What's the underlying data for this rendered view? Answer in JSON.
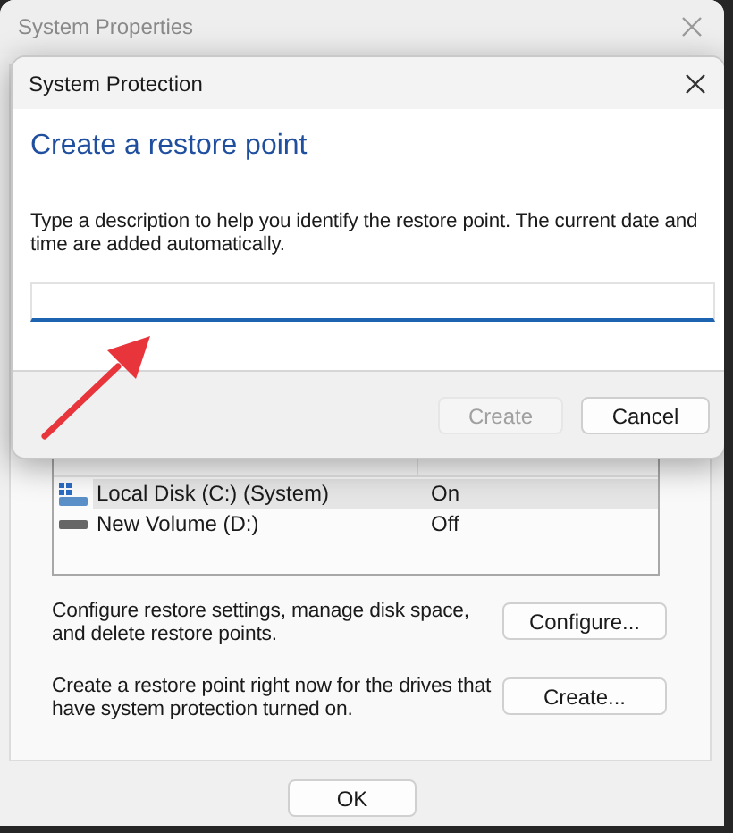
{
  "window": {
    "title": "System Properties"
  },
  "drives": {
    "rows": [
      {
        "kind": "system",
        "drive": "Local Disk (C:) (System)",
        "protection": "On",
        "selected": true
      },
      {
        "kind": "volume",
        "drive": "New Volume (D:)",
        "protection": "Off",
        "selected": false
      }
    ]
  },
  "actions": [
    {
      "description": "Configure restore settings, manage disk space, and delete restore points.",
      "button": "Configure..."
    },
    {
      "description": "Create a restore point right now for the drives that have system protection turned on.",
      "button": "Create..."
    }
  ],
  "footer_buttons": [
    "OK"
  ],
  "dialog": {
    "title": "System Protection",
    "heading": "Create a restore point",
    "description": "Type a description to help you identify the restore point. The current date and time are added automatically.",
    "buttons": [
      {
        "label": "Create",
        "disabled": true
      },
      {
        "label": "Cancel",
        "disabled": false
      }
    ]
  }
}
